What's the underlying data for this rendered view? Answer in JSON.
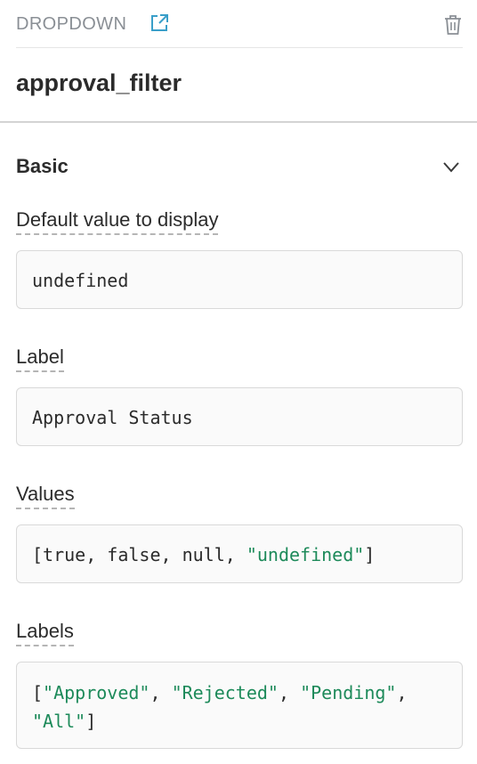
{
  "header": {
    "type_label": "DROPDOWN",
    "component_name": "approval_filter"
  },
  "section": {
    "title": "Basic"
  },
  "fields": {
    "default_value": {
      "label": "Default value to display",
      "value": "undefined"
    },
    "label": {
      "label": "Label",
      "value": "Approval Status"
    },
    "values": {
      "label": "Values",
      "tokens": [
        {
          "text": "[",
          "kind": "punct"
        },
        {
          "text": "true, false, null, ",
          "kind": "plain"
        },
        {
          "text": "\"undefined\"",
          "kind": "string"
        },
        {
          "text": "]",
          "kind": "punct"
        }
      ]
    },
    "labels": {
      "label": "Labels",
      "line1": [
        {
          "text": "[",
          "kind": "punct"
        },
        {
          "text": "\"Approved\"",
          "kind": "string"
        },
        {
          "text": ", ",
          "kind": "punct"
        },
        {
          "text": "\"Rejected\"",
          "kind": "string"
        },
        {
          "text": ", ",
          "kind": "punct"
        },
        {
          "text": "\"Pending\"",
          "kind": "string"
        },
        {
          "text": ",",
          "kind": "punct"
        }
      ],
      "line2": [
        {
          "text": "\"All\"",
          "kind": "string"
        },
        {
          "text": "]",
          "kind": "punct"
        }
      ]
    }
  },
  "colors": {
    "accent_icon": "#3a9fc9",
    "string_literal": "#1d8a5a",
    "muted_text": "#8a8f95"
  },
  "icons": {
    "open_external": "external-link-icon",
    "delete": "trash-icon",
    "collapse": "chevron-down-icon"
  }
}
